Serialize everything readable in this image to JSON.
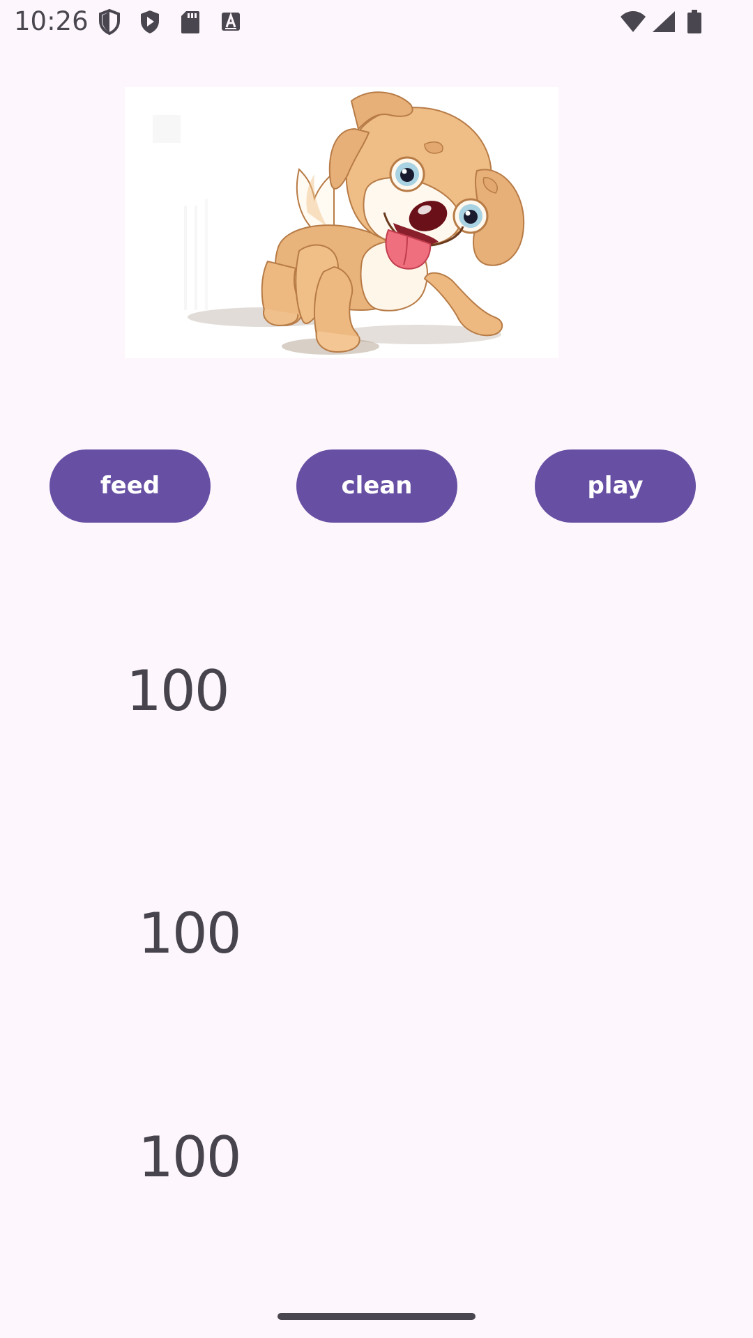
{
  "status_bar": {
    "time": "10:26",
    "left_icons": [
      "shield-outline-icon",
      "play-shield-icon",
      "sd-card-icon",
      "font-a-icon"
    ],
    "right_icons": [
      "wifi-icon",
      "cellular-signal-icon",
      "battery-icon"
    ]
  },
  "pet": {
    "image_subject": "cartoon puppy"
  },
  "actions": {
    "feed_label": "feed",
    "clean_label": "clean",
    "play_label": "play"
  },
  "stats": {
    "first_value": "100",
    "second_value": "100",
    "third_value": "100"
  },
  "colors": {
    "background": "#fdf6fc",
    "button": "#6750a4",
    "button_text": "#ffffff",
    "stat_text": "#48444e"
  }
}
